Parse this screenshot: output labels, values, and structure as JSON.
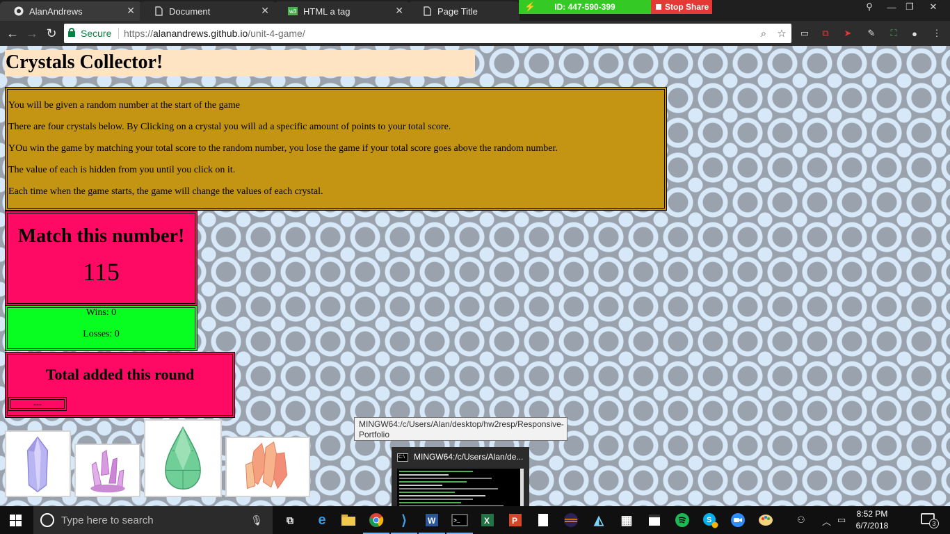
{
  "browser": {
    "tabs": [
      {
        "label": "AlanAndrews",
        "icon": "github-icon"
      },
      {
        "label": "Document",
        "icon": "page-icon"
      },
      {
        "label": "HTML a tag",
        "icon": "w3schools-icon"
      },
      {
        "label": "Page Title",
        "icon": "page-icon"
      }
    ],
    "share": {
      "id_label": "ID: 447-590-399",
      "stop_label": "Stop Share"
    },
    "omnibox": {
      "secure_label": "Secure",
      "url_scheme": "https://",
      "url_host": "alanandrews.github.io",
      "url_path": "/unit-4-game/"
    }
  },
  "page": {
    "title": "Crystals Collector!",
    "instructions": [
      "You will be given a random number at the start of the game",
      "There are four crystals below. By Clicking on a crystal you will ad a specific amount of points to your total score.",
      "YOu win the game by matching your total score to the random number, you lose the game if your total score goes above the random number.",
      "The value of each is hidden from you until you click on it.",
      "Each time when the game starts, the game will change the values of each crystal."
    ],
    "target": {
      "heading": "Match this number!",
      "value": "115"
    },
    "score": {
      "wins": "Wins: 0",
      "losses": "Losses: 0"
    },
    "added": {
      "heading": "Total added this round",
      "value": "---"
    },
    "crystals": [
      "blue-crystal",
      "purple-crystal",
      "green-crystal",
      "orange-crystal"
    ],
    "colors": {
      "title_bg": "#ffe4c4",
      "instructions_bg": "#c39513",
      "target_bg": "#fe0a64",
      "score_bg": "#08fe20"
    }
  },
  "overlay": {
    "tooltip": "MINGW64:/c/Users/Alan/desktop/hw2resp/Responsive-Portfolio",
    "preview_title": "MINGW64:/c/Users/Alan/de..."
  },
  "taskbar": {
    "search_placeholder": "Type here to search",
    "time": "8:52 PM",
    "date": "6/7/2018",
    "notification_count": "3"
  }
}
